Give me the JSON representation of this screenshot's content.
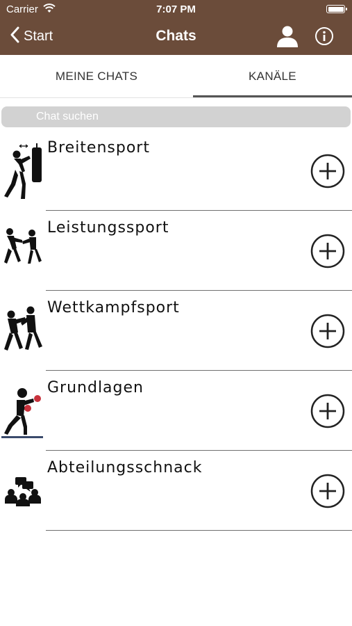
{
  "status_bar": {
    "carrier": "Carrier",
    "time": "7:07 PM"
  },
  "nav": {
    "back_label": "Start",
    "title": "Chats",
    "profile_icon": "person-icon",
    "info_icon": "info-icon"
  },
  "tabs": [
    {
      "label": "MEINE CHATS",
      "selected": false
    },
    {
      "label": "KANÄLE",
      "selected": true
    }
  ],
  "search": {
    "placeholder": "Chat suchen",
    "value": ""
  },
  "channels": [
    {
      "title": "Breitensport",
      "icon": "punching-bag-icon"
    },
    {
      "title": "Leistungssport",
      "icon": "sparring-icon"
    },
    {
      "title": "Wettkampfsport",
      "icon": "boxing-match-icon"
    },
    {
      "title": "Grundlagen",
      "icon": "boxer-red-gloves-icon"
    },
    {
      "title": "Abteilungsschnack",
      "icon": "group-chat-icon"
    }
  ],
  "colors": {
    "header": "#6b4c3a",
    "search_bg": "#d2d2d2",
    "divider": "#6f6f6f",
    "glove_red": "#c8323c"
  }
}
